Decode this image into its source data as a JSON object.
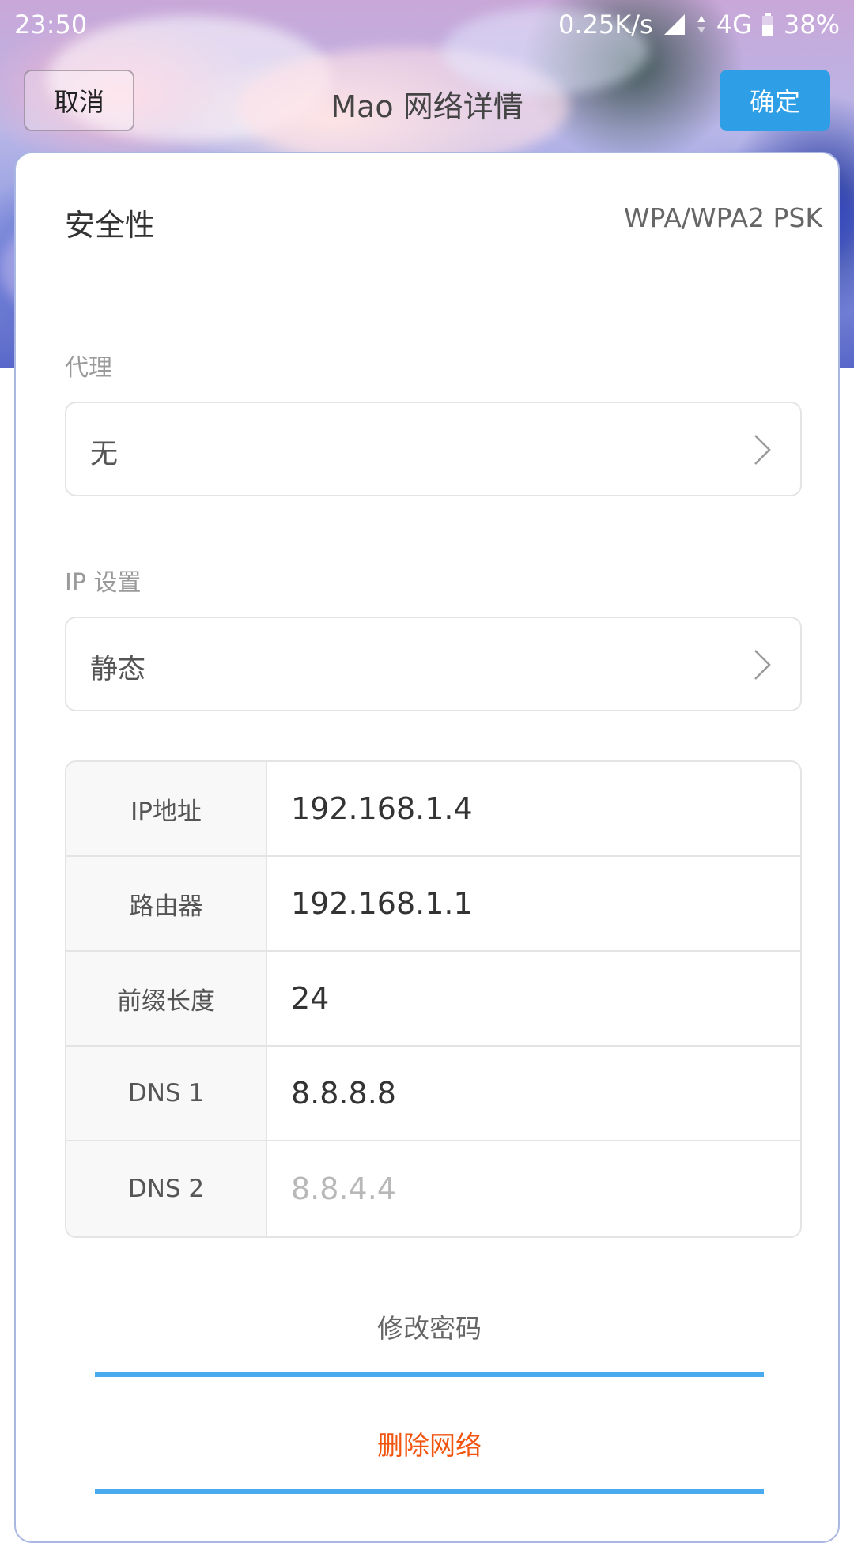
{
  "status_bar": {
    "time": "23:50",
    "speed": "0.25K/s",
    "network": "4G",
    "battery": "38%"
  },
  "title_bar": {
    "cancel_label": "取消",
    "title": "Mao 网络详情",
    "confirm_label": "确定"
  },
  "security": {
    "label": "安全性",
    "value": "WPA/WPA2 PSK"
  },
  "proxy": {
    "label": "代理",
    "value": "无"
  },
  "ip_settings": {
    "label": "IP 设置",
    "value": "静态"
  },
  "ip_table": [
    {
      "label": "IP地址",
      "value": "192.168.1.4",
      "placeholder": ""
    },
    {
      "label": "路由器",
      "value": "192.168.1.1",
      "placeholder": ""
    },
    {
      "label": "前缀长度",
      "value": "24",
      "placeholder": ""
    },
    {
      "label": "DNS 1",
      "value": "8.8.8.8",
      "placeholder": ""
    },
    {
      "label": "DNS 2",
      "value": "",
      "placeholder": "8.8.4.4"
    }
  ],
  "actions": {
    "change_password": "修改密码",
    "delete_network": "删除网络"
  },
  "colors": {
    "accent": "#2e9ee6",
    "underline": "#4aaaf0",
    "danger": "#f2540e"
  }
}
